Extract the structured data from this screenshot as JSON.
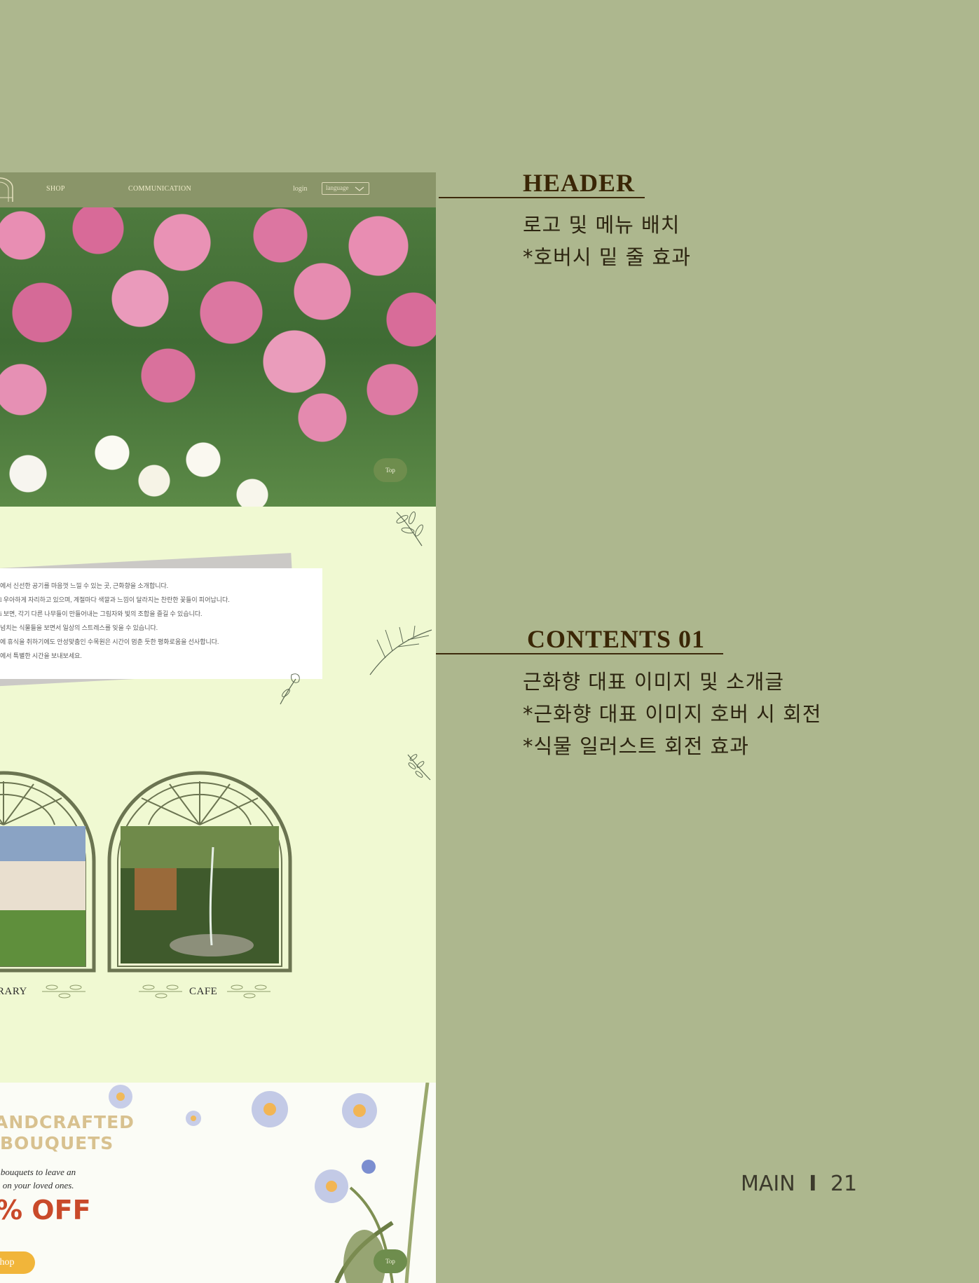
{
  "site": {
    "header": {
      "nav": [
        "SHOP",
        "COMMUNICATION"
      ],
      "login": "login",
      "language": "language"
    },
    "hero": {
      "top_label": "Top"
    },
    "intro": {
      "lines": [
        "에서 신선한 공기를 마음껏 느낄 수 있는 곳, 근화향을 소개합니다.",
        "l 우아하게 자리하고 있으며, 계절마다 색깔과 느낌이 달라지는 찬란한 꽃들이 피어납니다.",
        "i 보면, 각기 다른 나무들이 만들어내는 그림자와 빛의 조합을 즐길 수 있습니다.",
        "넘치는 식물들을 보면서 일상의 스트레스를 잊을 수 있습니다.",
        "에 휴식을 취하기에도 안성맞춤인 수목원은 시간이 멈춘 듯한 평화로움을 선사합니다.",
        "에서 특별한 시간을 보내보세요."
      ],
      "places": [
        "RARY",
        "CAFE"
      ]
    },
    "promo": {
      "title_line1": "ANDCRAFTED",
      "title_line2": "BOUQUETS",
      "copy_line1": "l bouquets to leave an",
      "copy_line2": "n on your loved ones.",
      "discount": "% OFF",
      "shop_button": "hop",
      "top_label": "Top"
    }
  },
  "annotations": {
    "header": {
      "title": "HEADER",
      "lines": [
        "로고 및 메뉴 배치",
        "*호버시 밑 줄 효과"
      ]
    },
    "contents01": {
      "title": "CONTENTS 01",
      "lines": [
        "근화향 대표 이미지 및 소개글",
        "*근화향 대표 이미지 호버 시 회전",
        "*식물 일러스트 회전 효과"
      ]
    }
  },
  "page_label": {
    "section": "MAIN",
    "separator": "I",
    "number": "21"
  },
  "colors": {
    "background": "#adb78e",
    "site_header": "#8a9569",
    "intro_bg": "#f0f9d2",
    "annotation_text": "#3a2606",
    "top_button": "#6e8d4d",
    "discount": "#c94a2a",
    "shop_button": "#f1b53a"
  },
  "icons": [
    "logo-icon",
    "chevron-down-icon",
    "leaf-icon",
    "arch-window-icon",
    "daisy-icon"
  ]
}
